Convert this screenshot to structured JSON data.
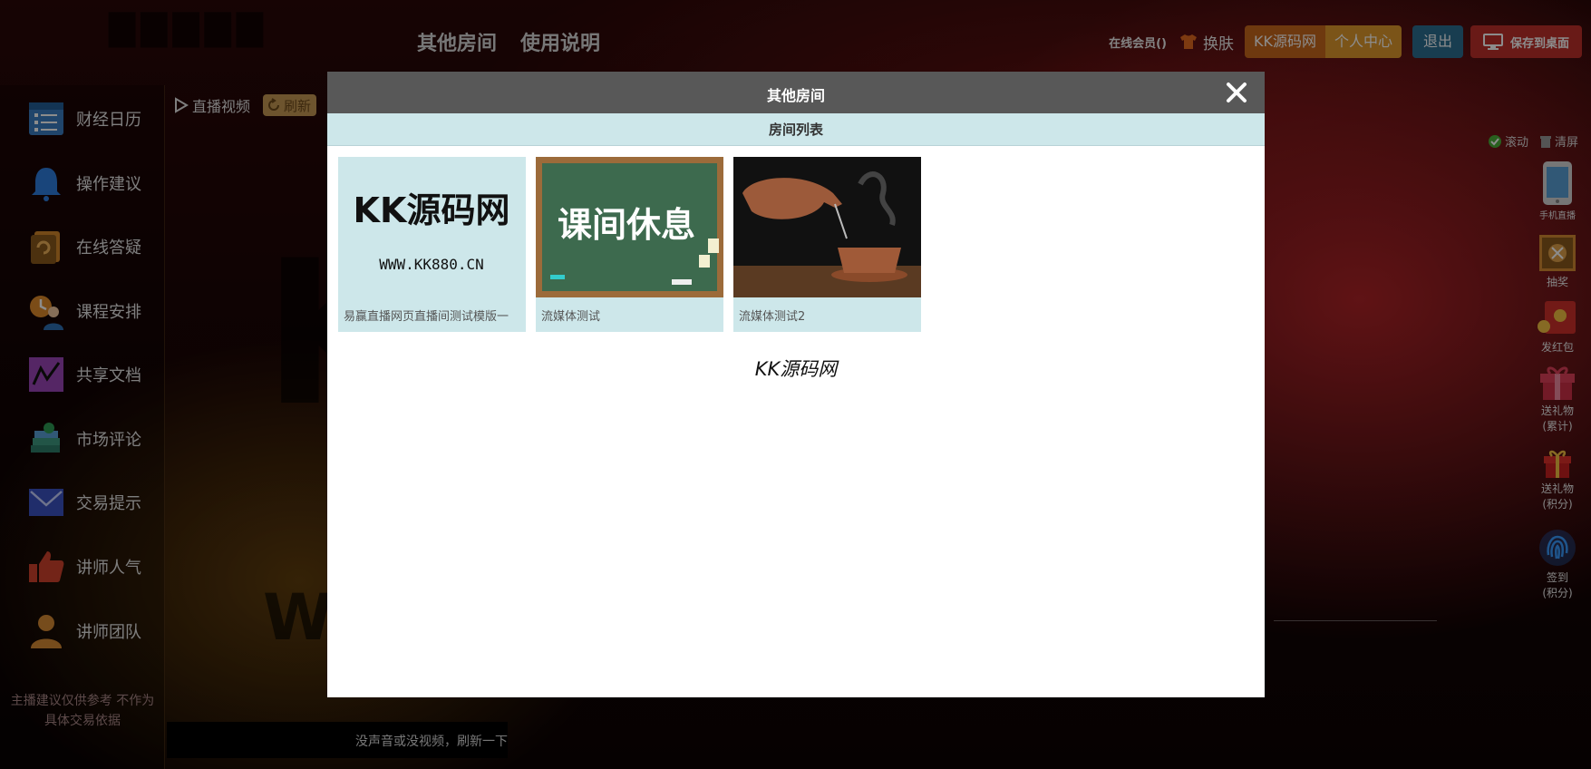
{
  "header": {
    "nav": [
      "其他房间",
      "使用说明"
    ],
    "online_label": "在线会员()",
    "skin_label": "换肤",
    "kk_label": "KK源码网",
    "center_label": "个人中心",
    "logout_label": "退出",
    "save_label": "保存到桌面"
  },
  "sidebar": {
    "items": [
      {
        "label": "财经日历",
        "icon": "calendar-icon"
      },
      {
        "label": "操作建议",
        "icon": "bell-icon"
      },
      {
        "label": "在线答疑",
        "icon": "qa-icon"
      },
      {
        "label": "课程安排",
        "icon": "schedule-icon"
      },
      {
        "label": "共享文档",
        "icon": "chart-doc-icon"
      },
      {
        "label": "市场评论",
        "icon": "books-icon"
      },
      {
        "label": "交易提示",
        "icon": "mail-icon"
      },
      {
        "label": "讲师人气",
        "icon": "thumbs-up-icon"
      },
      {
        "label": "讲师团队",
        "icon": "person-icon"
      }
    ],
    "note_line1": "主播建议仅供参考 不作为",
    "note_line2": "具体交易依据"
  },
  "video": {
    "tab_label": "直播视频",
    "refresh_label": "刷新",
    "message": "没声音或没视频，刷新一下"
  },
  "chat": {
    "scroll_label": "滚动",
    "clear_label": "清屏"
  },
  "right_bar": {
    "mobile_label": "手机直播",
    "lottery_label": "抽奖",
    "redpacket_label": "发红包",
    "gift_total_l1": "送礼物",
    "gift_total_l2": "(累计)",
    "gift_points_l1": "送礼物",
    "gift_points_l2": "(积分)",
    "sign_l1": "签到",
    "sign_l2": "(积分)"
  },
  "modal": {
    "title": "其他房间",
    "list_title": "房间列表",
    "rooms": [
      {
        "name": "易赢直播网页直播间测试模版一",
        "thumb_text1": "KK源码网",
        "thumb_text2": "WWW.KK880.CN"
      },
      {
        "name": "流媒体测试",
        "thumb_text1": "课间休息"
      },
      {
        "name": "流媒体测试2"
      }
    ],
    "brand": "KK源码网"
  },
  "colors": {
    "modal_header": "#585858",
    "list_bar": "#cde7ea",
    "save_button": "#c0302a",
    "logout_button": "#2c6f92",
    "kk_button": "#c9681c",
    "center_button": "#e09a2d"
  }
}
